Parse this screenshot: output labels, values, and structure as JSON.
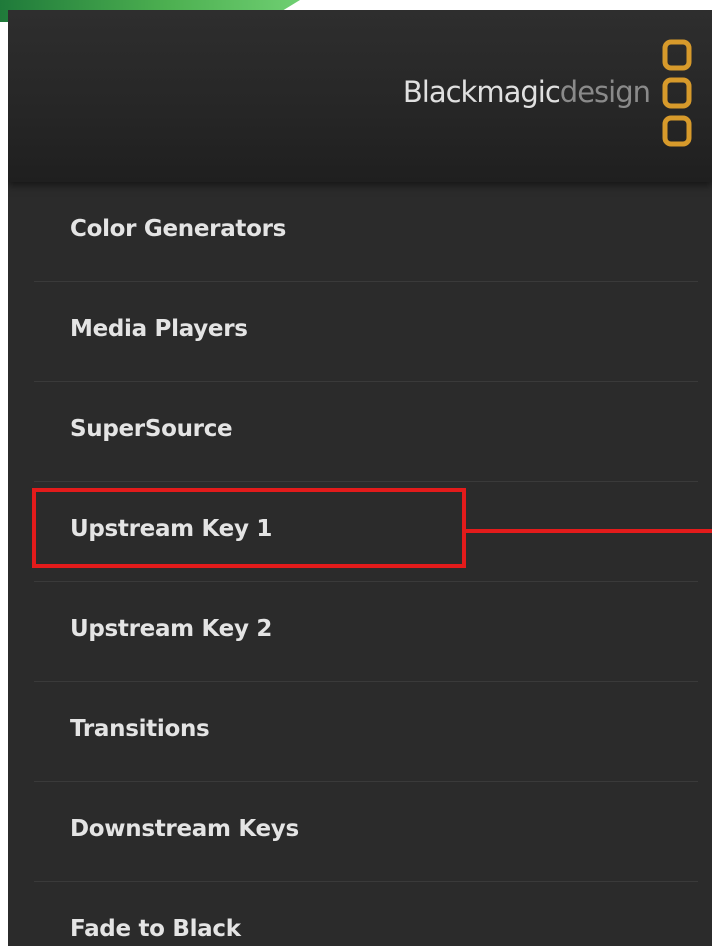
{
  "header": {
    "brand_strong": "Blackmagic",
    "brand_light": "design",
    "logo_icon": "blackmagic-three-rings-icon",
    "logo_color": "#d79a2b"
  },
  "menu": {
    "items": [
      {
        "label": "Color Generators"
      },
      {
        "label": "Media Players"
      },
      {
        "label": "SuperSource"
      },
      {
        "label": "Upstream Key 1"
      },
      {
        "label": "Upstream Key 2"
      },
      {
        "label": "Transitions"
      },
      {
        "label": "Downstream Keys"
      },
      {
        "label": "Fade to Black"
      }
    ]
  },
  "annotation": {
    "highlighted_item": "Upstream Key 1",
    "highlight_color": "#e31b1b"
  }
}
